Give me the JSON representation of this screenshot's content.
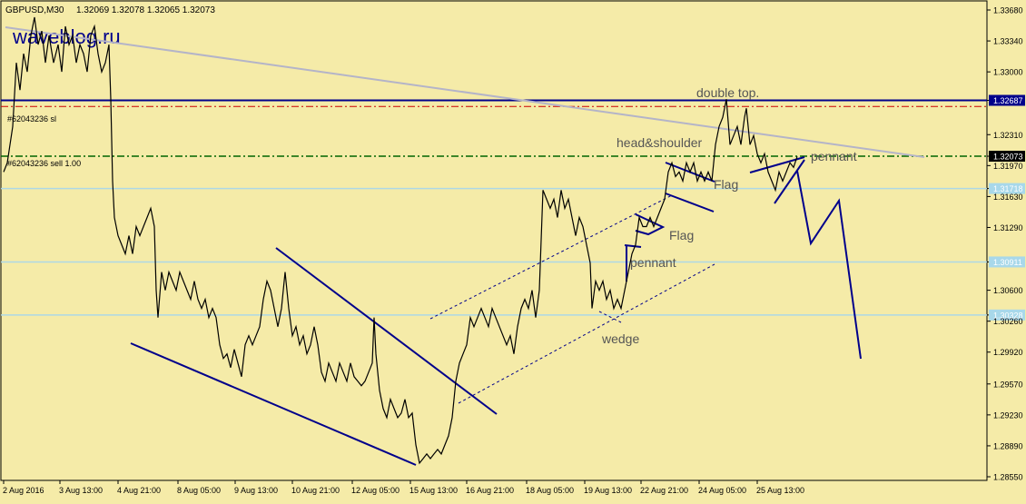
{
  "header": {
    "symbol": "GBPUSD,M30",
    "ohlc": "1.32069 1.32078 1.32065 1.32073"
  },
  "watermark": "waveblog.ru",
  "colors": {
    "background": "#f5eba8",
    "frame": "#000000",
    "price": "#000000",
    "trendline": "#00008b",
    "resistance": "#b4b4c8",
    "level": "#add8e6",
    "stop_line": "#cc0000",
    "entry_line": "#006400",
    "label_text": "#555555",
    "price_tag_dark": "#00008b",
    "price_tag_black": "#000000",
    "price_tag_light": "#a8d8ea"
  },
  "chart_data": {
    "type": "line",
    "title": "GBPUSD,M30",
    "ylim": [
      1.2853,
      1.3375
    ],
    "grid": false,
    "legend": "none",
    "y_ticks": [
      "1.33680",
      "1.33340",
      "1.33000",
      "1.32687",
      "1.32310",
      "1.32073",
      "1.31970",
      "1.31718",
      "1.31630",
      "1.31290",
      "1.30911",
      "1.30600",
      "1.30328",
      "1.30260",
      "1.29920",
      "1.29570",
      "1.29230",
      "1.28890",
      "1.28550"
    ],
    "x_ticks": [
      "2 Aug 2016",
      "3 Aug 13:00",
      "4 Aug 21:00",
      "8 Aug 05:00",
      "9 Aug 13:00",
      "10 Aug 21:00",
      "12 Aug 05:00",
      "15 Aug 13:00",
      "16 Aug 21:00",
      "18 Aug 05:00",
      "19 Aug 13:00",
      "22 Aug 21:00",
      "24 Aug 05:00",
      "25 Aug 13:00"
    ],
    "series": [
      {
        "values": [
          [
            0,
            1.319
          ],
          [
            4,
            1.32
          ],
          [
            10,
            1.324
          ],
          [
            14,
            1.331
          ],
          [
            18,
            1.328
          ],
          [
            22,
            1.332
          ],
          [
            26,
            1.33
          ],
          [
            30,
            1.334
          ],
          [
            34,
            1.336
          ],
          [
            38,
            1.333
          ],
          [
            42,
            1.3345
          ],
          [
            46,
            1.331
          ],
          [
            50,
            1.334
          ],
          [
            55,
            1.331
          ],
          [
            60,
            1.333
          ],
          [
            64,
            1.33
          ],
          [
            68,
            1.335
          ],
          [
            72,
            1.333
          ],
          [
            76,
            1.334
          ],
          [
            80,
            1.331
          ],
          [
            84,
            1.333
          ],
          [
            88,
            1.332
          ],
          [
            92,
            1.33
          ],
          [
            96,
            1.334
          ],
          [
            100,
            1.335
          ],
          [
            104,
            1.332
          ],
          [
            108,
            1.33
          ],
          [
            112,
            1.331
          ],
          [
            116,
            1.333
          ],
          [
            118,
            1.327
          ],
          [
            120,
            1.318
          ],
          [
            122,
            1.314
          ],
          [
            126,
            1.312
          ],
          [
            130,
            1.311
          ],
          [
            134,
            1.31
          ],
          [
            138,
            1.312
          ],
          [
            142,
            1.31
          ],
          [
            146,
            1.313
          ],
          [
            150,
            1.312
          ],
          [
            154,
            1.313
          ],
          [
            158,
            1.314
          ],
          [
            162,
            1.315
          ],
          [
            166,
            1.313
          ],
          [
            168,
            1.306
          ],
          [
            170,
            1.303
          ],
          [
            174,
            1.308
          ],
          [
            178,
            1.306
          ],
          [
            182,
            1.308
          ],
          [
            186,
            1.307
          ],
          [
            190,
            1.306
          ],
          [
            194,
            1.308
          ],
          [
            198,
            1.307
          ],
          [
            202,
            1.306
          ],
          [
            206,
            1.305
          ],
          [
            210,
            1.307
          ],
          [
            214,
            1.305
          ],
          [
            218,
            1.304
          ],
          [
            222,
            1.305
          ],
          [
            226,
            1.303
          ],
          [
            230,
            1.304
          ],
          [
            234,
            1.303
          ],
          [
            238,
            1.3
          ],
          [
            242,
            1.2985
          ],
          [
            246,
            1.299
          ],
          [
            250,
            1.2975
          ],
          [
            254,
            1.2995
          ],
          [
            258,
            1.298
          ],
          [
            262,
            1.2965
          ],
          [
            266,
            1.3
          ],
          [
            270,
            1.301
          ],
          [
            274,
            1.3
          ],
          [
            278,
            1.301
          ],
          [
            282,
            1.302
          ],
          [
            286,
            1.305
          ],
          [
            290,
            1.307
          ],
          [
            294,
            1.306
          ],
          [
            298,
            1.304
          ],
          [
            302,
            1.302
          ],
          [
            306,
            1.304
          ],
          [
            310,
            1.308
          ],
          [
            314,
            1.304
          ],
          [
            318,
            1.301
          ],
          [
            322,
            1.302
          ],
          [
            326,
            1.3
          ],
          [
            330,
            1.301
          ],
          [
            334,
            1.299
          ],
          [
            338,
            1.3
          ],
          [
            342,
            1.302
          ],
          [
            346,
            1.3
          ],
          [
            350,
            1.297
          ],
          [
            354,
            1.296
          ],
          [
            358,
            1.298
          ],
          [
            362,
            1.297
          ],
          [
            366,
            1.296
          ],
          [
            370,
            1.298
          ],
          [
            374,
            1.297
          ],
          [
            378,
            1.296
          ],
          [
            382,
            1.298
          ],
          [
            386,
            1.2965
          ],
          [
            390,
            1.296
          ],
          [
            394,
            1.2955
          ],
          [
            398,
            1.296
          ],
          [
            402,
            1.297
          ],
          [
            406,
            1.298
          ],
          [
            408,
            1.303
          ],
          [
            410,
            1.299
          ],
          [
            414,
            1.295
          ],
          [
            418,
            1.293
          ],
          [
            422,
            1.292
          ],
          [
            426,
            1.294
          ],
          [
            430,
            1.293
          ],
          [
            434,
            1.292
          ],
          [
            438,
            1.2925
          ],
          [
            442,
            1.294
          ],
          [
            446,
            1.292
          ],
          [
            450,
            1.2925
          ],
          [
            454,
            1.289
          ],
          [
            458,
            1.287
          ],
          [
            462,
            1.2875
          ],
          [
            466,
            1.288
          ],
          [
            470,
            1.2875
          ],
          [
            474,
            1.288
          ],
          [
            478,
            1.2885
          ],
          [
            482,
            1.288
          ],
          [
            486,
            1.289
          ],
          [
            490,
            1.29
          ],
          [
            494,
            1.292
          ],
          [
            498,
            1.296
          ],
          [
            502,
            1.298
          ],
          [
            506,
            1.299
          ],
          [
            510,
            1.3
          ],
          [
            514,
            1.303
          ],
          [
            518,
            1.302
          ],
          [
            522,
            1.303
          ],
          [
            526,
            1.304
          ],
          [
            530,
            1.303
          ],
          [
            534,
            1.302
          ],
          [
            538,
            1.304
          ],
          [
            542,
            1.303
          ],
          [
            546,
            1.302
          ],
          [
            550,
            1.301
          ],
          [
            554,
            1.3
          ],
          [
            558,
            1.301
          ],
          [
            562,
            1.299
          ],
          [
            566,
            1.302
          ],
          [
            570,
            1.304
          ],
          [
            574,
            1.305
          ],
          [
            578,
            1.304
          ],
          [
            582,
            1.306
          ],
          [
            586,
            1.303
          ],
          [
            590,
            1.306
          ],
          [
            594,
            1.317
          ],
          [
            598,
            1.316
          ],
          [
            602,
            1.315
          ],
          [
            606,
            1.316
          ],
          [
            610,
            1.314
          ],
          [
            614,
            1.317
          ],
          [
            618,
            1.315
          ],
          [
            622,
            1.316
          ],
          [
            626,
            1.314
          ],
          [
            630,
            1.312
          ],
          [
            634,
            1.314
          ],
          [
            638,
            1.313
          ],
          [
            642,
            1.311
          ],
          [
            646,
            1.309
          ],
          [
            648,
            1.304
          ],
          [
            652,
            1.307
          ],
          [
            656,
            1.306
          ],
          [
            660,
            1.307
          ],
          [
            664,
            1.305
          ],
          [
            668,
            1.306
          ],
          [
            672,
            1.304
          ],
          [
            676,
            1.305
          ],
          [
            680,
            1.304
          ],
          [
            684,
            1.306
          ],
          [
            688,
            1.308
          ],
          [
            692,
            1.31
          ],
          [
            696,
            1.311
          ],
          [
            700,
            1.314
          ],
          [
            704,
            1.313
          ],
          [
            708,
            1.313
          ],
          [
            712,
            1.314
          ],
          [
            716,
            1.313
          ],
          [
            720,
            1.314
          ],
          [
            724,
            1.315
          ],
          [
            728,
            1.316
          ],
          [
            732,
            1.319
          ],
          [
            736,
            1.32
          ],
          [
            740,
            1.3185
          ],
          [
            744,
            1.319
          ],
          [
            748,
            1.318
          ],
          [
            752,
            1.32
          ],
          [
            756,
            1.319
          ],
          [
            760,
            1.32
          ],
          [
            764,
            1.318
          ],
          [
            768,
            1.319
          ],
          [
            772,
            1.318
          ],
          [
            776,
            1.319
          ],
          [
            780,
            1.318
          ],
          [
            784,
            1.322
          ],
          [
            788,
            1.324
          ],
          [
            792,
            1.325
          ],
          [
            796,
            1.327
          ],
          [
            800,
            1.322
          ],
          [
            804,
            1.323
          ],
          [
            808,
            1.324
          ],
          [
            812,
            1.322
          ],
          [
            816,
            1.325
          ],
          [
            818,
            1.326
          ],
          [
            822,
            1.322
          ],
          [
            826,
            1.323
          ],
          [
            830,
            1.321
          ],
          [
            834,
            1.32
          ],
          [
            838,
            1.321
          ],
          [
            842,
            1.319
          ],
          [
            846,
            1.318
          ],
          [
            850,
            1.317
          ],
          [
            854,
            1.319
          ],
          [
            858,
            1.318
          ],
          [
            862,
            1.319
          ],
          [
            866,
            1.32
          ],
          [
            870,
            1.3195
          ],
          [
            874,
            1.3207
          ]
        ]
      }
    ]
  },
  "levels": [
    {
      "price": "1.32687",
      "style": "solid",
      "color_key": "trendline"
    },
    {
      "price": "1.32073",
      "style": "dashdot",
      "color_key": "entry_line"
    },
    {
      "price": "1.31718",
      "style": "solid",
      "color_key": "level"
    },
    {
      "price": "1.30911",
      "style": "solid",
      "color_key": "level"
    },
    {
      "price": "1.30328",
      "style": "solid",
      "color_key": "level"
    }
  ],
  "order_labels": {
    "sl": "#62043236 sl",
    "sell": "#62043236 sell 1.00"
  },
  "annotations": {
    "double_top": "double top.",
    "head_shoulder": "head&shoulder",
    "pennant_right": "pennant",
    "flag_upper": "Flag",
    "flag_lower": "Flag",
    "pennant_left": "pennant",
    "wedge": "wedge"
  }
}
